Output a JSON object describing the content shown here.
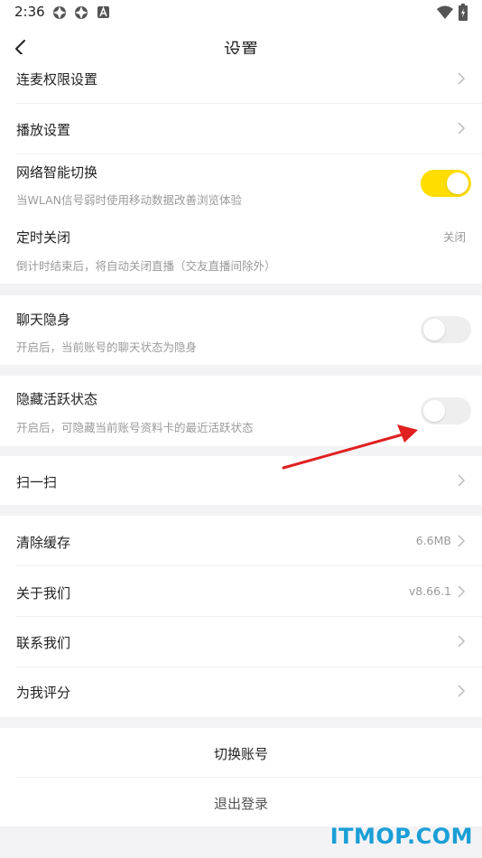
{
  "status_bar": {
    "time": "2:36"
  },
  "header": {
    "title": "设置"
  },
  "sections": {
    "lianmai": {
      "label": "连麦权限设置"
    },
    "playback": {
      "label": "播放设置"
    },
    "network": {
      "label": "网络智能切换",
      "desc": "当WLAN信号弱时使用移动数据改善浏览体验",
      "enabled": true
    },
    "timer": {
      "label": "定时关闭",
      "value": "关闭",
      "desc": "倒计时结束后，将自动关闭直播（交友直播间除外）"
    },
    "chat_invisible": {
      "label": "聊天隐身",
      "desc": "开启后，当前账号的聊天状态为隐身",
      "enabled": false
    },
    "hide_active": {
      "label": "隐藏活跃状态",
      "desc": "开启后，可隐藏当前账号资料卡的最近活跃状态",
      "enabled": false
    },
    "scan": {
      "label": "扫一扫"
    },
    "clear_cache": {
      "label": "清除缓存",
      "value": "6.6MB"
    },
    "about": {
      "label": "关于我们",
      "value": "v8.66.1"
    },
    "contact": {
      "label": "联系我们"
    },
    "rate": {
      "label": "为我评分"
    }
  },
  "actions": {
    "switch_account": "切换账号",
    "logout": "退出登录"
  },
  "watermark": "ITMOP.COM",
  "colors": {
    "toggle_on": "#ffdd00",
    "toggle_off": "#eeeeee",
    "section_gap": "#f3f3f5",
    "annotation_arrow": "#e02020"
  }
}
